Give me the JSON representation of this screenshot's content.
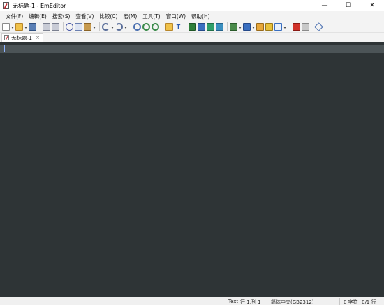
{
  "window": {
    "title": "无标题-1 - EmEditor"
  },
  "window_controls": {
    "minimize": "—",
    "maximize": "☐",
    "close": "✕"
  },
  "menu": [
    "文件(F)",
    "编辑(E)",
    "搜索(S)",
    "查看(V)",
    "比较(C)",
    "宏(M)",
    "工具(T)",
    "窗口(W)",
    "帮助(H)"
  ],
  "toolbar": {
    "buttons": [
      "new-icon",
      "open-icon",
      "save-icon",
      "print-icon",
      "print-preview-icon",
      "cut-icon",
      "copy-icon",
      "paste-icon",
      "undo-icon",
      "redo-icon",
      "find-icon",
      "find-next-icon",
      "find-prev-icon",
      "find-in-files-icon",
      "text-icon",
      "view-1-icon",
      "view-2-icon",
      "view-3-icon",
      "view-4-icon",
      "marker-icon",
      "macro-icon",
      "pencil-icon",
      "pencil-2-icon",
      "frame-icon",
      "record-stop-icon",
      "play-icon",
      "tools-icon"
    ],
    "text_button_label": "T"
  },
  "tabs": [
    {
      "label": "无标题-1",
      "close": "×"
    }
  ],
  "editor": {
    "background": "#2e3436",
    "current_line": "#4c5457",
    "caret": "#8fb3ff"
  },
  "status": {
    "mode": "Text",
    "position": "行 1,列 1",
    "encoding": "简体中文(GB2312)",
    "chars": "0 字符",
    "lines": "0/1 行"
  }
}
